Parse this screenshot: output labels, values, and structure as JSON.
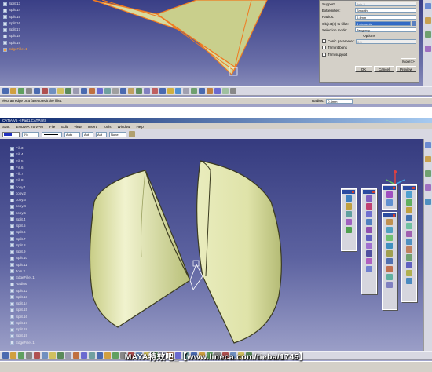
{
  "top": {
    "tree": [
      "Split.13",
      "Split.14",
      "Split.15",
      "Split.16",
      "Split.17",
      "Split.18",
      "Split.19",
      "EdgeFillet.1"
    ],
    "dialog": {
      "support_label": "Support:",
      "support_value": "Join.2",
      "extremities_label": "Extremities:",
      "extremities_value": "Smooth",
      "radius_label": "Radius:",
      "radius_value": "0.4mm",
      "objects_label": "Object(s) to fillet:",
      "objects_value": "3 elements",
      "selection_label": "Selection mode:",
      "selection_value": "Tangency",
      "options_label": "Options",
      "conic_label": "Conic parameter:",
      "conic_value": "0.5",
      "trim_ribbons_label": "Trim ribbons",
      "trim_support_label": "Trim support",
      "more_label": "More>>",
      "ok_label": "OK",
      "cancel_label": "Cancel",
      "preview_label": "Preview"
    },
    "status_text": "elect an edge or a face to edit the fillet.",
    "radius_status_label": "Radius:",
    "radius_status_value": "0.4mm"
  },
  "bottom": {
    "title_bar": "CATIA V5 - [Part1.CATPart]",
    "menu": [
      "Start",
      "ENOVIA V5 VPM",
      "File",
      "Edit",
      "View",
      "Insert",
      "Tools",
      "Window",
      "Help"
    ],
    "props": {
      "color_value": "",
      "percent_value": "0%",
      "line_value": "",
      "auto1": "Auto",
      "aut2": "Aut",
      "aut3": "Aut",
      "none_value": "None"
    },
    "tree": [
      "Fill.3",
      "Fill.4",
      "Fill.5",
      "Fill.6",
      "Fill.7",
      "Fill.8",
      "copy.1",
      "copy.2",
      "copy.3",
      "copy.4",
      "copy.5",
      "Split.4",
      "Split.5",
      "Split.6",
      "Split.7",
      "Split.8",
      "Split.9",
      "Split.10",
      "Split.11",
      "Join.2",
      "EdgeFillet.1",
      "Radius",
      "Split.12",
      "Split.13",
      "Split.14",
      "Split.15",
      "Split.16",
      "Split.17",
      "Split.18",
      "Split.19",
      "EdgeFillet.1"
    ]
  },
  "watermark": "MAYA特效吧_【www.lineca.com/tieba/1745】",
  "colors": {
    "surface": "#dde3a8",
    "surface_dark": "#b9c07c",
    "edge": "#3b3b20",
    "bg_top": "#3a3f86",
    "bg_bottom": "#9fa2c7"
  }
}
